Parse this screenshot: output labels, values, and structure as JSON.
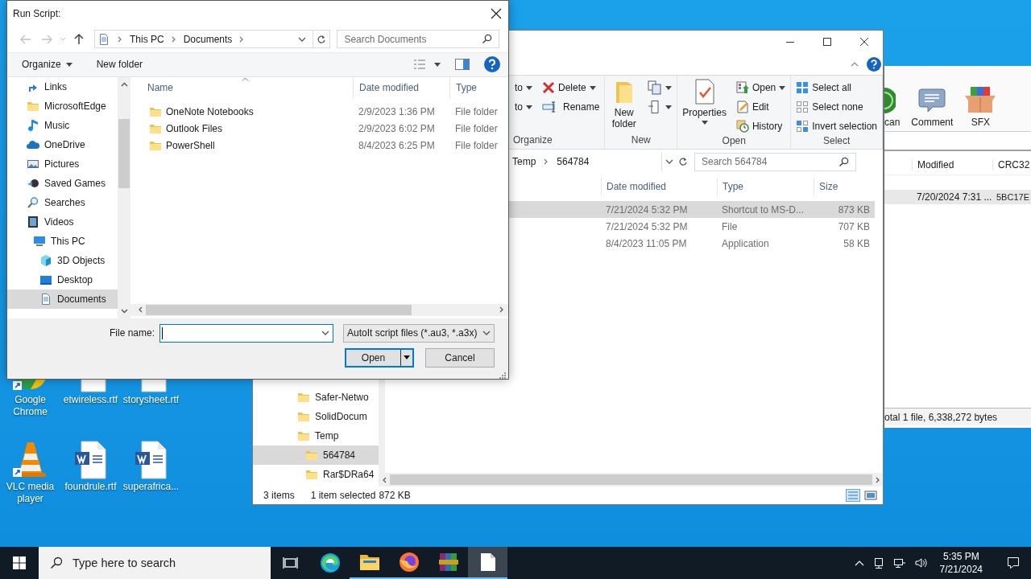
{
  "desktop_icons": [
    {
      "label": "Google Chrome",
      "kind": "chrome"
    },
    {
      "label": "etwireless.rtf",
      "kind": "word"
    },
    {
      "label": "storysheet.rtf",
      "kind": "word"
    },
    {
      "label": "VLC media player",
      "kind": "vlc"
    },
    {
      "label": "foundrule.rtf",
      "kind": "word"
    },
    {
      "label": "superafrica...",
      "kind": "word"
    }
  ],
  "winrar": {
    "toolbar": [
      {
        "label": "can",
        "kind": "scan"
      },
      {
        "label": "Comment",
        "kind": "comment"
      },
      {
        "label": "SFX",
        "kind": "sfx"
      }
    ],
    "columns": [
      "Modified",
      "CRC32"
    ],
    "rows": [
      {
        "modified": "7/20/2024 7:31 ...",
        "crc32": "5BC17E",
        "selected": true
      }
    ],
    "status": "otal 1 file, 6,338,272 bytes"
  },
  "explorer": {
    "ribbon": [
      {
        "label": "Organize",
        "columns": [
          [
            {
              "label": "to",
              "kind": "copy-to",
              "dropdown": true
            },
            {
              "label": "to",
              "kind": "move-to",
              "dropdown": true
            }
          ],
          [
            {
              "label": "Delete",
              "kind": "delete",
              "dropdown": true
            },
            {
              "label": "Rename",
              "kind": "rename",
              "dropdown": false
            }
          ]
        ]
      },
      {
        "label": "New",
        "columns": [
          [
            {
              "label": "New folder",
              "kind": "new-folder",
              "dropdown": false
            }
          ],
          [
            {
              "kind": "new-item",
              "dropdown": true
            },
            {
              "kind": "easy-access",
              "dropdown": true
            }
          ]
        ]
      },
      {
        "label": "Open",
        "columns": [
          [
            {
              "label": "Properties",
              "kind": "properties",
              "dropdown": true
            }
          ],
          [
            {
              "label": "Open",
              "kind": "open",
              "dropdown": true
            },
            {
              "label": "Edit",
              "kind": "edit",
              "dropdown": false
            },
            {
              "label": "History",
              "kind": "history",
              "dropdown": false
            }
          ]
        ]
      },
      {
        "label": "Select",
        "columns": [
          [
            {
              "label": "Select all",
              "kind": "select-all",
              "dropdown": false
            },
            {
              "label": "Select none",
              "kind": "select-none",
              "dropdown": false
            },
            {
              "label": "Invert selection",
              "kind": "invert",
              "dropdown": false
            }
          ]
        ]
      }
    ],
    "address": [
      "Temp",
      "564784"
    ],
    "search_placeholder": "Search 564784",
    "columns": [
      "Date modified",
      "Type",
      "Size"
    ],
    "rows": [
      {
        "date": "7/21/2024 5:32 PM",
        "type": "Shortcut to MS-D...",
        "size": "873 KB",
        "selected": true
      },
      {
        "date": "7/21/2024 5:32 PM",
        "type": "File",
        "size": "707 KB",
        "selected": false
      },
      {
        "date": "8/4/2023 11:05 PM",
        "type": "Application",
        "size": "58 KB",
        "selected": false
      }
    ],
    "nav": [
      {
        "label": "Safer-Netwo",
        "selected": false
      },
      {
        "label": "SolidDocum",
        "selected": false
      },
      {
        "label": "Temp",
        "selected": false,
        "children": [
          {
            "label": "564784",
            "selected": true
          },
          {
            "label": "Rar$DRa64",
            "selected": false
          }
        ]
      }
    ],
    "status": {
      "count": "3 items",
      "selection": "1 item selected",
      "size": "872 KB"
    }
  },
  "dialog": {
    "title": "Run Script:",
    "breadcrumb": [
      "This PC",
      "Documents"
    ],
    "search_placeholder": "Search Documents",
    "organize": "Organize",
    "new_folder": "New folder",
    "nav": [
      {
        "children": [
          {
            "label": "Links",
            "kind": "links",
            "selected": false
          },
          {
            "label": "MicrosoftEdge",
            "kind": "folder",
            "selected": false
          },
          {
            "label": "Music",
            "kind": "music",
            "selected": false
          },
          {
            "label": "OneDrive",
            "kind": "onedrive",
            "selected": false
          },
          {
            "label": "Pictures",
            "kind": "pictures",
            "selected": false
          },
          {
            "label": "Saved Games",
            "kind": "games",
            "selected": false
          },
          {
            "label": "Searches",
            "kind": "searches",
            "selected": false
          },
          {
            "label": "Videos",
            "kind": "videos",
            "selected": false
          }
        ]
      },
      {
        "label": "This PC",
        "kind": "pc",
        "selected": false,
        "children": [
          {
            "label": "3D Objects",
            "kind": "objects",
            "selected": false
          },
          {
            "label": "Desktop",
            "kind": "desktop",
            "selected": false
          },
          {
            "label": "Documents",
            "kind": "documents",
            "selected": true
          }
        ]
      }
    ],
    "columns": [
      {
        "label": "Name",
        "sorted": true
      },
      {
        "label": "Date modified",
        "sorted": false
      },
      {
        "label": "Type",
        "sorted": false
      }
    ],
    "files": [
      {
        "name": "OneNote Notebooks",
        "date": "2/9/2023 1:36 PM",
        "type": "File folder",
        "selected": false
      },
      {
        "name": "Outlook Files",
        "date": "2/9/2023 6:02 PM",
        "type": "File folder",
        "selected": false
      },
      {
        "name": "PowerShell",
        "date": "8/4/2023 6:25 PM",
        "type": "File folder",
        "selected": false
      }
    ],
    "file_name_label": "File name:",
    "file_name_focused": true,
    "filter": "AutoIt script files (*.au3, *.a3x)",
    "open": "Open",
    "cancel": "Cancel"
  },
  "taskbar": {
    "search_placeholder": "Type here to search",
    "apps": [
      {
        "kind": "task-view",
        "running": false,
        "active": false
      },
      {
        "kind": "edge",
        "running": false,
        "active": false
      },
      {
        "kind": "explorer",
        "running": true,
        "active": false
      },
      {
        "kind": "firefox",
        "running": true,
        "active": false
      },
      {
        "kind": "winrar",
        "running": true,
        "active": false
      },
      {
        "kind": "notepad",
        "running": true,
        "active": true
      }
    ],
    "time": "5:35 PM",
    "date": "7/21/2024"
  }
}
